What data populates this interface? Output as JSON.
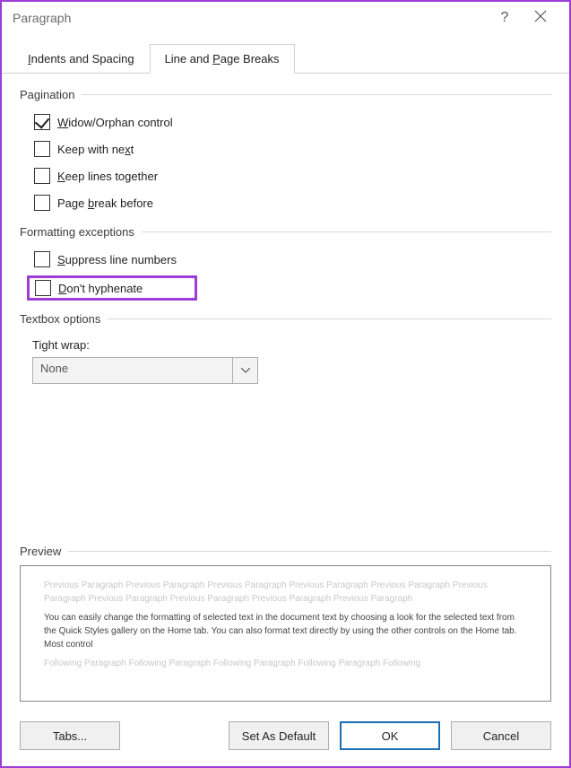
{
  "titlebar": {
    "title": "Paragraph"
  },
  "tabs": {
    "t0": "Indents and Spacing",
    "t1": "Line and Page Breaks"
  },
  "sections": {
    "pagination": "Pagination",
    "formatting": "Formatting exceptions",
    "textbox": "Textbox options",
    "preview": "Preview"
  },
  "checks": {
    "widow_pre": "W",
    "widow_post": "idow/Orphan control",
    "keepnext_pre": "Keep with ne",
    "keepnext_u": "x",
    "keepnext_post": "t",
    "keeplines_u": "K",
    "keeplines_post": "eep lines together",
    "pagebreak_pre": "Page ",
    "pagebreak_u": "b",
    "pagebreak_post": "reak before",
    "suppress_u": "S",
    "suppress_post": "uppress line numbers",
    "dont_u": "D",
    "dont_post": "on't hyphenate"
  },
  "tightwrap": {
    "label": "Tight wrap:",
    "value": "None"
  },
  "preview": {
    "ghost1": "Previous Paragraph Previous Paragraph Previous Paragraph Previous Paragraph Previous Paragraph Previous Paragraph Previous Paragraph Previous Paragraph Previous Paragraph Previous Paragraph",
    "sample": "You can easily change the formatting of selected text in the document text by choosing a look for the selected text from the Quick Styles gallery on the Home tab. You can also format text directly by using the other controls on the Home tab. Most control",
    "ghost2": "Following Paragraph Following Paragraph Following Paragraph Following Paragraph Following"
  },
  "buttons": {
    "tabs_pre": "T",
    "tabs_post": "abs...",
    "default_pre": "Set As ",
    "default_u": "D",
    "default_post": "efault",
    "ok": "OK",
    "cancel": "Cancel"
  }
}
